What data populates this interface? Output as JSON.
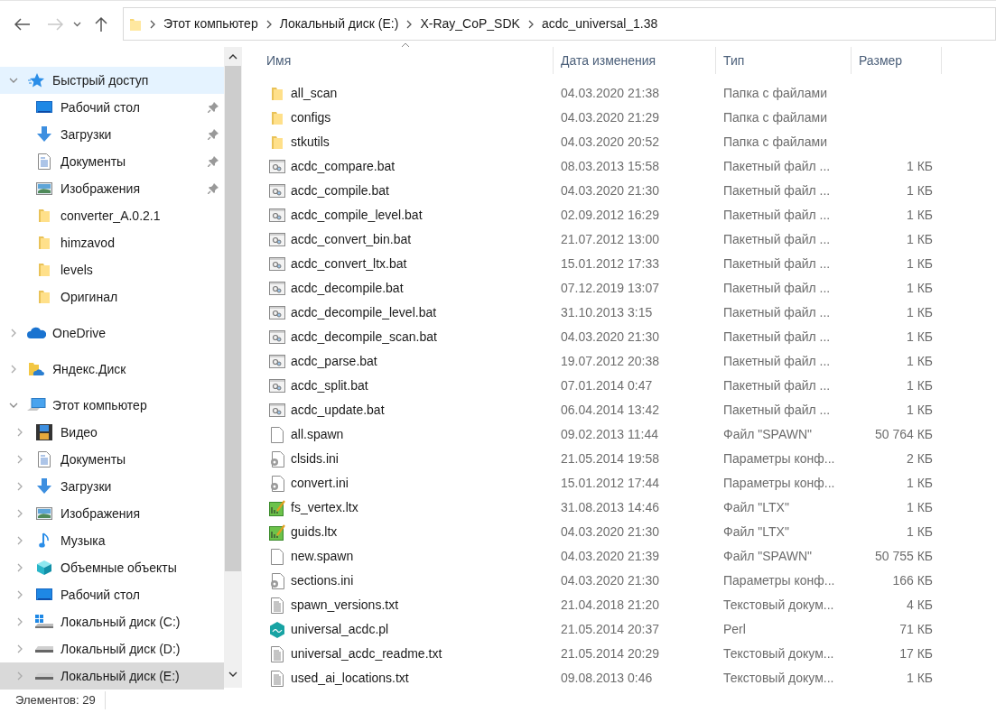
{
  "nav": {
    "breadcrumb": [
      "Этот компьютер",
      "Локальный диск (E:)",
      "X-Ray_CoP_SDK",
      "acdc_universal_1.38"
    ]
  },
  "sidebar": {
    "items": [
      {
        "label": "Быстрый доступ",
        "kind": "star",
        "expanded": true,
        "hovered": true,
        "selected": false,
        "children": [
          {
            "label": "Рабочий стол",
            "kind": "desktop",
            "pinned": true,
            "selected": false
          },
          {
            "label": "Загрузки",
            "kind": "download",
            "pinned": true,
            "selected": false
          },
          {
            "label": "Документы",
            "kind": "documents",
            "pinned": true,
            "selected": false
          },
          {
            "label": "Изображения",
            "kind": "pictures",
            "pinned": true,
            "selected": false
          },
          {
            "label": "converter_A.0.2.1",
            "kind": "folder",
            "pinned": false,
            "selected": false
          },
          {
            "label": "himzavod",
            "kind": "folder",
            "pinned": false,
            "selected": false
          },
          {
            "label": "levels",
            "kind": "folder",
            "pinned": false,
            "selected": false
          },
          {
            "label": "Оригинал",
            "kind": "folder",
            "pinned": false,
            "selected": false
          }
        ]
      },
      {
        "label": "OneDrive",
        "kind": "cloud",
        "expanded": false,
        "hovered": false,
        "selected": false
      },
      {
        "label": "Яндекс.Диск",
        "kind": "yandex",
        "expanded": false,
        "hovered": false,
        "selected": false
      },
      {
        "label": "Этот компьютер",
        "kind": "pc",
        "expanded": true,
        "hovered": false,
        "selected": false,
        "children": [
          {
            "label": "Видео",
            "kind": "video",
            "expanded": false,
            "selected": false
          },
          {
            "label": "Документы",
            "kind": "documents",
            "expanded": false,
            "selected": false
          },
          {
            "label": "Загрузки",
            "kind": "download",
            "expanded": false,
            "selected": false
          },
          {
            "label": "Изображения",
            "kind": "pictures",
            "expanded": false,
            "selected": false
          },
          {
            "label": "Музыка",
            "kind": "music",
            "expanded": false,
            "selected": false
          },
          {
            "label": "Объемные объекты",
            "kind": "cube",
            "expanded": false,
            "selected": false
          },
          {
            "label": "Рабочий стол",
            "kind": "desktop",
            "expanded": false,
            "selected": false
          },
          {
            "label": "Локальный диск (C:)",
            "kind": "drive-win",
            "expanded": false,
            "selected": false
          },
          {
            "label": "Локальный диск (D:)",
            "kind": "drive",
            "expanded": false,
            "selected": false
          },
          {
            "label": "Локальный диск (E:)",
            "kind": "drive",
            "expanded": false,
            "selected": true
          }
        ]
      }
    ]
  },
  "table": {
    "columns": [
      "Имя",
      "Дата изменения",
      "Тип",
      "Размер"
    ],
    "rows": [
      {
        "name": "all_scan",
        "kind": "folder",
        "date": "04.03.2020 21:38",
        "type": "Папка с файлами"
      },
      {
        "name": "configs",
        "kind": "folder",
        "date": "04.03.2020 21:29",
        "type": "Папка с файлами"
      },
      {
        "name": "stkutils",
        "kind": "folder",
        "date": "04.03.2020 20:52",
        "type": "Папка с файлами"
      },
      {
        "name": "acdc_compare.bat",
        "kind": "bat",
        "date": "08.03.2013 15:58",
        "type": "Пакетный файл ...",
        "size": "1 КБ"
      },
      {
        "name": "acdc_compile.bat",
        "kind": "bat",
        "date": "04.03.2020 21:30",
        "type": "Пакетный файл ...",
        "size": "1 КБ"
      },
      {
        "name": "acdc_compile_level.bat",
        "kind": "bat",
        "date": "02.09.2012 16:29",
        "type": "Пакетный файл ...",
        "size": "1 КБ"
      },
      {
        "name": "acdc_convert_bin.bat",
        "kind": "bat",
        "date": "21.07.2012 13:00",
        "type": "Пакетный файл ...",
        "size": "1 КБ"
      },
      {
        "name": "acdc_convert_ltx.bat",
        "kind": "bat",
        "date": "15.01.2012 17:33",
        "type": "Пакетный файл ...",
        "size": "1 КБ"
      },
      {
        "name": "acdc_decompile.bat",
        "kind": "bat",
        "date": "07.12.2019 13:07",
        "type": "Пакетный файл ...",
        "size": "1 КБ"
      },
      {
        "name": "acdc_decompile_level.bat",
        "kind": "bat",
        "date": "31.10.2013 3:15",
        "type": "Пакетный файл ...",
        "size": "1 КБ"
      },
      {
        "name": "acdc_decompile_scan.bat",
        "kind": "bat",
        "date": "04.03.2020 21:30",
        "type": "Пакетный файл ...",
        "size": "1 КБ"
      },
      {
        "name": "acdc_parse.bat",
        "kind": "bat",
        "date": "19.07.2012 20:38",
        "type": "Пакетный файл ...",
        "size": "1 КБ"
      },
      {
        "name": "acdc_split.bat",
        "kind": "bat",
        "date": "07.01.2014 0:47",
        "type": "Пакетный файл ...",
        "size": "1 КБ"
      },
      {
        "name": "acdc_update.bat",
        "kind": "bat",
        "date": "06.04.2014 13:42",
        "type": "Пакетный файл ...",
        "size": "1 КБ"
      },
      {
        "name": "all.spawn",
        "kind": "blank",
        "date": "09.02.2013 11:44",
        "type": "Файл \"SPAWN\"",
        "size": "50 764 КБ"
      },
      {
        "name": "clsids.ini",
        "kind": "ini",
        "date": "21.05.2014 19:58",
        "type": "Параметры конф...",
        "size": "2 КБ"
      },
      {
        "name": "convert.ini",
        "kind": "ini",
        "date": "15.01.2012 17:44",
        "type": "Параметры конф...",
        "size": "1 КБ"
      },
      {
        "name": "fs_vertex.ltx",
        "kind": "ltx",
        "date": "31.08.2013 14:46",
        "type": "Файл \"LTX\"",
        "size": "1 КБ"
      },
      {
        "name": "guids.ltx",
        "kind": "ltx",
        "date": "04.03.2020 21:30",
        "type": "Файл \"LTX\"",
        "size": "1 КБ"
      },
      {
        "name": "new.spawn",
        "kind": "blank",
        "date": "04.03.2020 21:39",
        "type": "Файл \"SPAWN\"",
        "size": "50 755 КБ"
      },
      {
        "name": "sections.ini",
        "kind": "ini",
        "date": "04.03.2020 21:30",
        "type": "Параметры конф...",
        "size": "166 КБ"
      },
      {
        "name": "spawn_versions.txt",
        "kind": "txt",
        "date": "21.04.2018 21:20",
        "type": "Текстовый докум...",
        "size": "4 КБ"
      },
      {
        "name": "universal_acdc.pl",
        "kind": "perl",
        "date": "21.05.2014 20:37",
        "type": "Perl",
        "size": "71 КБ"
      },
      {
        "name": "universal_acdc_readme.txt",
        "kind": "txt",
        "date": "21.05.2014 20:29",
        "type": "Текстовый докум...",
        "size": "17 КБ"
      },
      {
        "name": "used_ai_locations.txt",
        "kind": "txt",
        "date": "09.08.2013 0:46",
        "type": "Текстовый докум...",
        "size": "1 КБ"
      }
    ]
  },
  "status_bar": {
    "count": "Элементов: 29"
  }
}
